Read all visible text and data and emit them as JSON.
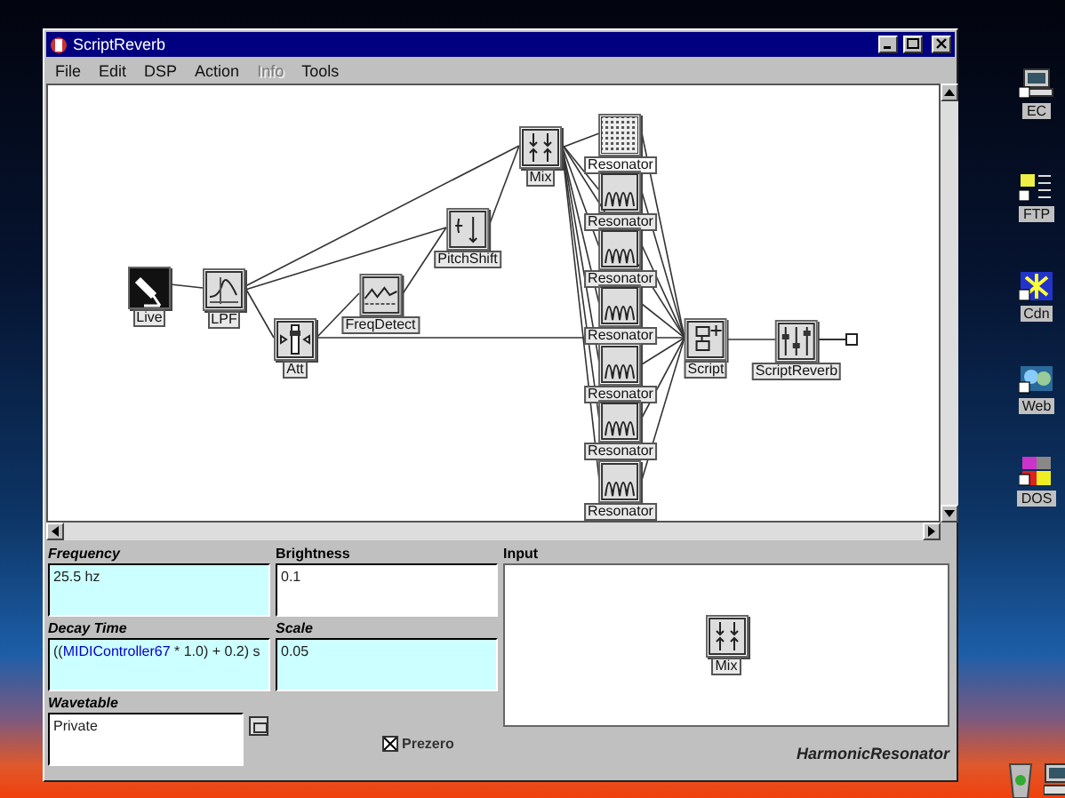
{
  "desktop": {
    "icons": [
      {
        "label": "EC",
        "kind": "computer"
      },
      {
        "label": "FTP",
        "kind": "folder"
      },
      {
        "label": "Cdn",
        "kind": "app"
      },
      {
        "label": "Web",
        "kind": "web"
      },
      {
        "label": "DOS",
        "kind": "dos"
      }
    ]
  },
  "window": {
    "title": "ScriptReverb"
  },
  "menu": [
    {
      "label": "File",
      "disabled": false
    },
    {
      "label": "Edit",
      "disabled": false
    },
    {
      "label": "DSP",
      "disabled": false
    },
    {
      "label": "Action",
      "disabled": false
    },
    {
      "label": "Info",
      "disabled": true
    },
    {
      "label": "Tools",
      "disabled": false
    }
  ],
  "canvas": {
    "nodes": [
      {
        "label": "Live",
        "kind": "mic",
        "selected": false
      },
      {
        "label": "LPF",
        "kind": "filter",
        "selected": false
      },
      {
        "label": "Att",
        "kind": "fader",
        "selected": false
      },
      {
        "label": "FreqDetect",
        "kind": "detect",
        "selected": false
      },
      {
        "label": "PitchShift",
        "kind": "pitch",
        "selected": false
      },
      {
        "label": "Mix",
        "kind": "mix",
        "selected": false
      },
      {
        "label": "Resonator",
        "kind": "resonator",
        "selected": true
      },
      {
        "label": "Resonator",
        "kind": "resonator",
        "selected": false
      },
      {
        "label": "Resonator",
        "kind": "resonator",
        "selected": false
      },
      {
        "label": "Resonator",
        "kind": "resonator",
        "selected": false
      },
      {
        "label": "Resonator",
        "kind": "resonator",
        "selected": false
      },
      {
        "label": "Resonator",
        "kind": "resonator",
        "selected": false
      },
      {
        "label": "Resonator",
        "kind": "resonator",
        "selected": false
      },
      {
        "label": "Script",
        "kind": "script",
        "selected": false
      },
      {
        "label": "ScriptReverb",
        "kind": "reverb",
        "selected": false
      }
    ]
  },
  "inspector": {
    "params": [
      {
        "label": "Frequency",
        "shaded": true,
        "value_parts": [
          {
            "text": "25.5 hz",
            "kind": "plain"
          }
        ]
      },
      {
        "label": "Brightness",
        "shaded": false,
        "value_parts": [
          {
            "text": "0.1",
            "kind": "plain"
          }
        ]
      },
      {
        "label": "Decay Time",
        "shaded": true,
        "value_parts": [
          {
            "text": "((",
            "kind": "plain"
          },
          {
            "text": "MIDIController67",
            "kind": "reference"
          },
          {
            "text": " * 1.0) + 0.2) s",
            "kind": "plain"
          }
        ]
      },
      {
        "label": "Scale",
        "shaded": true,
        "value_parts": [
          {
            "text": "0.05",
            "kind": "plain"
          }
        ]
      }
    ],
    "wavetable": {
      "label": "Wavetable",
      "value": "Private"
    },
    "prezero": {
      "label": "Prezero",
      "checked": true
    },
    "input": {
      "label": "Input",
      "node": {
        "label": "Mix",
        "kind": "mix"
      }
    },
    "module": "HarmonicResonator"
  }
}
